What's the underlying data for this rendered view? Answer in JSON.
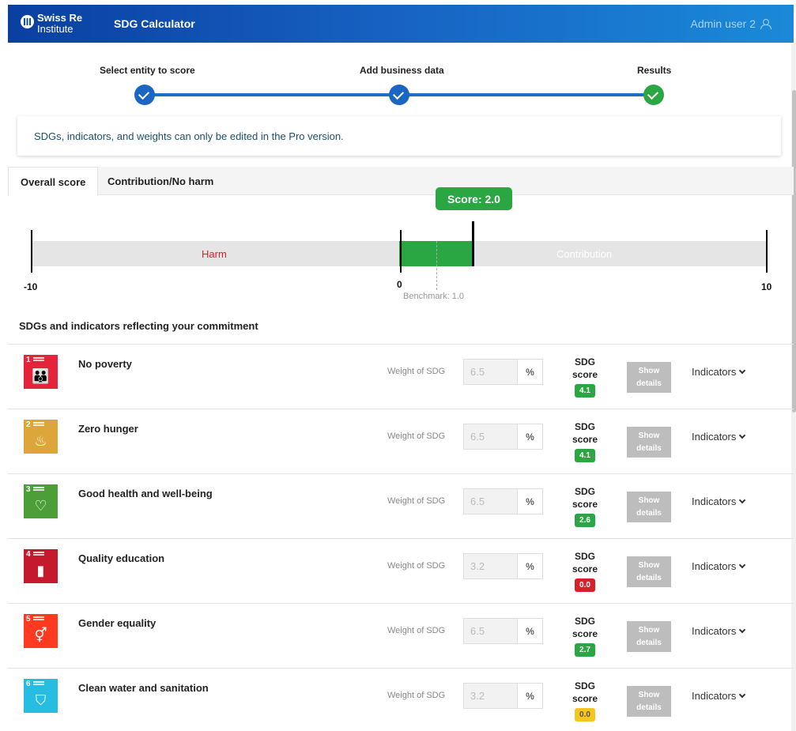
{
  "header": {
    "logo_line1": "Swiss Re",
    "logo_line2": "Institute",
    "app_title": "SDG Calculator",
    "user": "Admin user 2"
  },
  "stepper": {
    "steps": [
      {
        "label": "Select entity to score",
        "status": "complete"
      },
      {
        "label": "Add business data",
        "status": "complete"
      },
      {
        "label": "Results",
        "status": "current"
      }
    ]
  },
  "notice": "SDGs, indicators, and weights can only be edited in the Pro version.",
  "tabs": [
    {
      "label": "Overall score",
      "active": true
    },
    {
      "label": "Contribution/No harm",
      "active": false
    }
  ],
  "score_bar": {
    "score_label": "Score: 2.0",
    "score": 2.0,
    "benchmark": 1.0,
    "benchmark_label": "Benchmark: 1.0",
    "min": -10,
    "max": 10,
    "min_label": "-10",
    "zero_label": "0",
    "max_label": "10",
    "harm_label": "Harm",
    "contribution_label": "Contribution"
  },
  "section_title": "SDGs and indicators reflecting your commitment",
  "weight_label": "Weight of SDG",
  "percent_symbol": "%",
  "sdg_score_label_1": "SDG",
  "sdg_score_label_2": "score",
  "show_details_1": "Show",
  "show_details_2": "details",
  "indicators_label": "Indicators",
  "colors": {
    "score_green": "#2aa643",
    "harm_red": "#d6202c",
    "accent_blue": "#1a66c2"
  },
  "sdgs": [
    {
      "num": "1",
      "name": "No poverty",
      "weight": "6.5",
      "score": "4.1",
      "status": "green",
      "color": "#e5243b",
      "glyph": "👪",
      "icon": "family-icon"
    },
    {
      "num": "2",
      "name": "Zero hunger",
      "weight": "6.5",
      "score": "4.1",
      "status": "green",
      "color": "#dda63a",
      "glyph": "♨",
      "icon": "bowl-icon"
    },
    {
      "num": "3",
      "name": "Good health and well-being",
      "weight": "6.5",
      "score": "2.6",
      "status": "green",
      "color": "#4c9f38",
      "glyph": "♡",
      "icon": "heartbeat-icon"
    },
    {
      "num": "4",
      "name": "Quality education",
      "weight": "3.2",
      "score": "0.0",
      "status": "red",
      "color": "#c5192d",
      "glyph": "▮",
      "icon": "book-icon"
    },
    {
      "num": "5",
      "name": "Gender equality",
      "weight": "6.5",
      "score": "2.7",
      "status": "green",
      "color": "#ff3a21",
      "glyph": "⚥",
      "icon": "gender-icon"
    },
    {
      "num": "6",
      "name": "Clean water and sanitation",
      "weight": "3.2",
      "score": "0.0",
      "status": "yellow",
      "color": "#26bde2",
      "glyph": "⛉",
      "icon": "water-glass-icon"
    }
  ]
}
